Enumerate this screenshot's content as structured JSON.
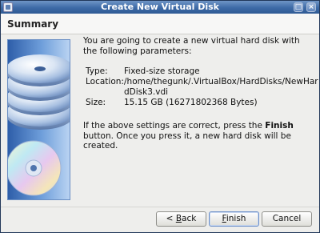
{
  "window": {
    "title": "Create New Virtual Disk"
  },
  "header": {
    "title": "Summary"
  },
  "content": {
    "intro": "You are going to create a new virtual hard disk with the following parameters:",
    "params": [
      {
        "key": "Type:",
        "value": "Fixed-size storage"
      },
      {
        "key": "Location:",
        "value": "/home/thegunk/.VirtualBox/HardDisks/NewHardDisk3.vdi"
      },
      {
        "key": "Size:",
        "value": "15.15 GB (16271802368 Bytes)"
      }
    ],
    "note": {
      "before": "If the above settings are correct, press the ",
      "bold": "Finish",
      "after": " button. Once you press it, a new hard disk will be created."
    }
  },
  "buttons": {
    "back_prefix": "< ",
    "back_mnemonic": "B",
    "back_rest": "ack",
    "finish_mnemonic": "F",
    "finish_rest": "inish",
    "cancel": "Cancel"
  },
  "icons": {
    "titlebar": "window-menu-icon",
    "maximize": "maximize-icon",
    "close": "close-icon",
    "illustration": "disk-stack-illustration"
  },
  "colors": {
    "titlebar": "#3d6aa6",
    "panel_bg": "#eeeeec",
    "illustration_blue": "#2e5ea9"
  }
}
